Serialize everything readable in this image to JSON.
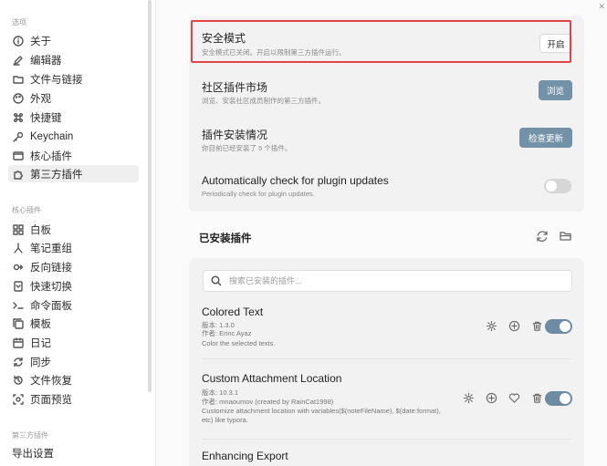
{
  "sidebar": {
    "section_options": "选项",
    "options_items": [
      {
        "label": "关于",
        "icon": "info-circle-icon"
      },
      {
        "label": "编辑器",
        "icon": "pencil-icon"
      },
      {
        "label": "文件与链接",
        "icon": "folder-link-icon"
      },
      {
        "label": "外观",
        "icon": "palette-icon"
      },
      {
        "label": "快捷键",
        "icon": "command-icon"
      },
      {
        "label": "Keychain",
        "icon": "key-icon"
      },
      {
        "label": "核心插件",
        "icon": "monitor-icon"
      },
      {
        "label": "第三方插件",
        "icon": "puzzle-icon",
        "active": true
      }
    ],
    "section_core": "核心插件",
    "core_items": [
      {
        "label": "白板",
        "icon": "grid-icon"
      },
      {
        "label": "笔记重组",
        "icon": "compose-icon"
      },
      {
        "label": "反向链接",
        "icon": "backlink-icon"
      },
      {
        "label": "快速切换",
        "icon": "switch-icon"
      },
      {
        "label": "命令面板",
        "icon": "terminal-icon"
      },
      {
        "label": "模板",
        "icon": "template-icon"
      },
      {
        "label": "日记",
        "icon": "calendar-icon"
      },
      {
        "label": "同步",
        "icon": "sync-icon"
      },
      {
        "label": "文件恢复",
        "icon": "history-icon"
      },
      {
        "label": "页面预览",
        "icon": "preview-icon"
      }
    ],
    "section_third": "第三方插件",
    "third_items": [
      {
        "label": "导出设置"
      }
    ]
  },
  "settings": {
    "safe_mode": {
      "title": "安全模式",
      "desc": "安全模式已关闭。开启以限制第三方插件运行。",
      "button": "开启"
    },
    "market": {
      "title": "社区插件市场",
      "desc": "浏览、安装社区成员制作的第三方插件。",
      "button": "浏览"
    },
    "install_status": {
      "title": "插件安装情况",
      "desc": "你目前已经安装了 5 个插件。",
      "button": "检查更新"
    },
    "auto_check": {
      "title": "Automatically check for plugin updates",
      "desc": "Periodically check for plugin updates.",
      "enabled": false
    }
  },
  "installed": {
    "title": "已安装插件",
    "search_placeholder": "搜索已安装的插件...",
    "plugins": [
      {
        "name": "Colored Text",
        "version": "版本: 1.3.0",
        "author": "作者: Erinc Ayaz",
        "desc": "Color the selected texts.",
        "enabled": true
      },
      {
        "name": "Custom Attachment Location",
        "version": "版本: 10.3.1",
        "author": "作者: mnaoumov (created by RainCat1998)",
        "desc": "Customize attachment location with variables($(noteFileName), $(date:format), etc) like typora.",
        "enabled": true
      },
      {
        "name": "Enhancing Export"
      }
    ]
  },
  "colors": {
    "accent": "#6d8ca3",
    "button_blue": "#7391a7",
    "highlight": "#e04444"
  }
}
